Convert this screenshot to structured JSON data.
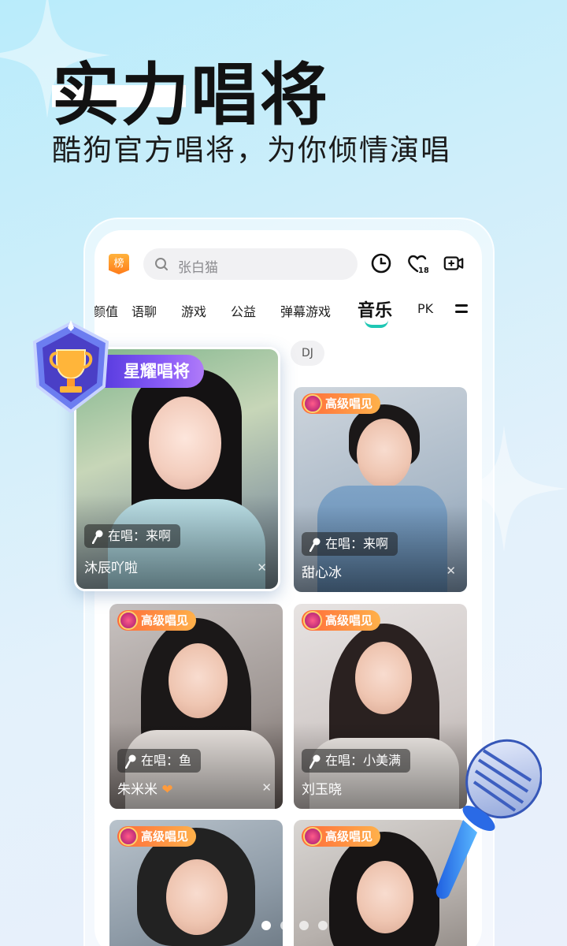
{
  "hero": {
    "title": "实力唱将",
    "subtitle": "酷狗官方唱将，为你倾情演唱"
  },
  "topbar": {
    "rank_label": "榜",
    "search_placeholder": "张白猫",
    "history_icon": "clock-icon",
    "follow_icon": "heart-18-icon",
    "live_icon": "video-plus-icon"
  },
  "tabs": [
    {
      "label": "颜值"
    },
    {
      "label": "语聊"
    },
    {
      "label": "游戏"
    },
    {
      "label": "公益"
    },
    {
      "label": "弹幕游戏"
    },
    {
      "label": "音乐",
      "active": true
    },
    {
      "label": "PK"
    }
  ],
  "filter_chip": "DJ",
  "featured": {
    "badge": "星耀唱将",
    "singing": "在唱：来啊",
    "name": "沐辰吖啦"
  },
  "cards": [
    {
      "tag": "高级唱见",
      "singing": "在唱：来啊",
      "name": "甜心冰"
    },
    {
      "tag": "高级唱见",
      "singing": "在唱：鱼",
      "name": "朱米米"
    },
    {
      "tag": "高级唱见",
      "singing": "在唱：小美满",
      "name": "刘玉晓"
    },
    {
      "tag": "高级唱见"
    },
    {
      "tag": "高级唱见"
    }
  ],
  "colors": {
    "accent": "#1ec7b4",
    "tag_gold": "#ff8a3d",
    "featured_purple": "#6a45e8"
  },
  "pager": {
    "count": 4,
    "active": 1
  }
}
